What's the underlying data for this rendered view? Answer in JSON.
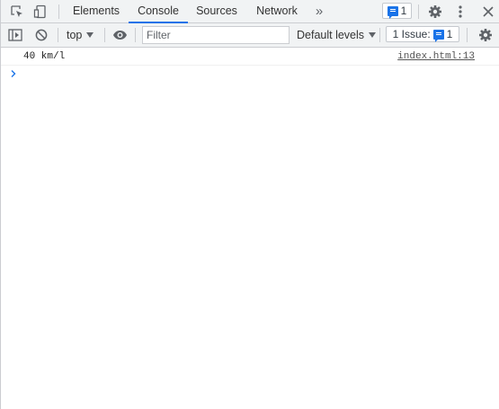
{
  "tabs": [
    {
      "label": "Elements",
      "active": false
    },
    {
      "label": "Console",
      "active": true
    },
    {
      "label": "Sources",
      "active": false
    },
    {
      "label": "Network",
      "active": false
    }
  ],
  "tabbar": {
    "issues_count": "1"
  },
  "toolbar": {
    "context": "top",
    "filter_placeholder": "Filter",
    "levels": "Default levels",
    "issues_label": "1 Issue:",
    "issues_count": "1"
  },
  "console": {
    "messages": [
      {
        "text": "40 km/l",
        "source": "index.html:13"
      }
    ]
  },
  "colors": {
    "accent": "#1a73e8",
    "toolbar_bg": "#f1f3f4",
    "border": "#cbcdd1"
  },
  "icons": [
    "inspect-element-icon",
    "device-toolbar-icon",
    "more-tabs-icon",
    "settings-icon",
    "more-options-icon",
    "close-icon",
    "sidebar-toggle-icon",
    "clear-console-icon",
    "eye-icon",
    "message-icon",
    "prompt-chevron-icon"
  ]
}
